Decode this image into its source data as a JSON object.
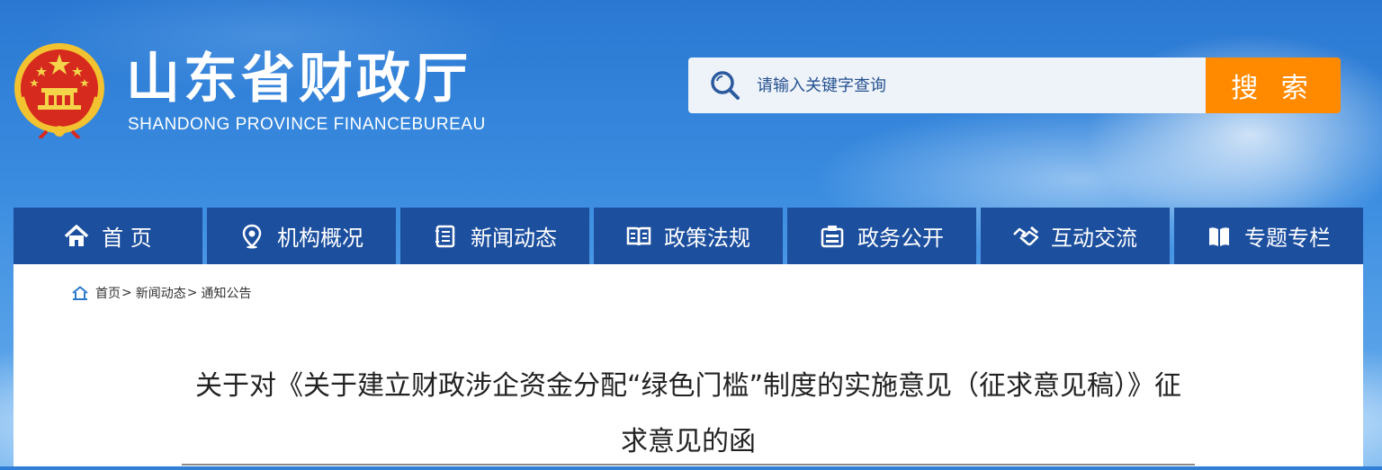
{
  "header": {
    "title": "山东省财政厅",
    "subtitle": "SHANDONG PROVINCE FINANCEBUREAU",
    "emblem_icon": "national-emblem-icon"
  },
  "search": {
    "placeholder": "请输入关键字查询",
    "button_label": "搜 索",
    "icon": "search-icon"
  },
  "nav": {
    "items": [
      {
        "label": "首 页",
        "icon": "home-icon"
      },
      {
        "label": "机构概况",
        "icon": "location-pin-icon"
      },
      {
        "label": "新闻动态",
        "icon": "notebook-icon"
      },
      {
        "label": "政策法规",
        "icon": "open-book-icon"
      },
      {
        "label": "政务公开",
        "icon": "document-icon"
      },
      {
        "label": "互动交流",
        "icon": "handshake-icon"
      },
      {
        "label": "专题专栏",
        "icon": "book-icon"
      }
    ]
  },
  "breadcrumb": {
    "icon": "home-outline-icon",
    "items": [
      "首页",
      "新闻动态",
      "通知公告"
    ],
    "separator": ">"
  },
  "article": {
    "title": "关于对《关于建立财政涉企资金分配“绿色门槛”制度的实施意见（征求意见稿）》征求意见的函"
  },
  "colors": {
    "nav_bg": "#1d4f9f",
    "search_button": "#ff8a00",
    "search_box": "#eef3fa"
  }
}
